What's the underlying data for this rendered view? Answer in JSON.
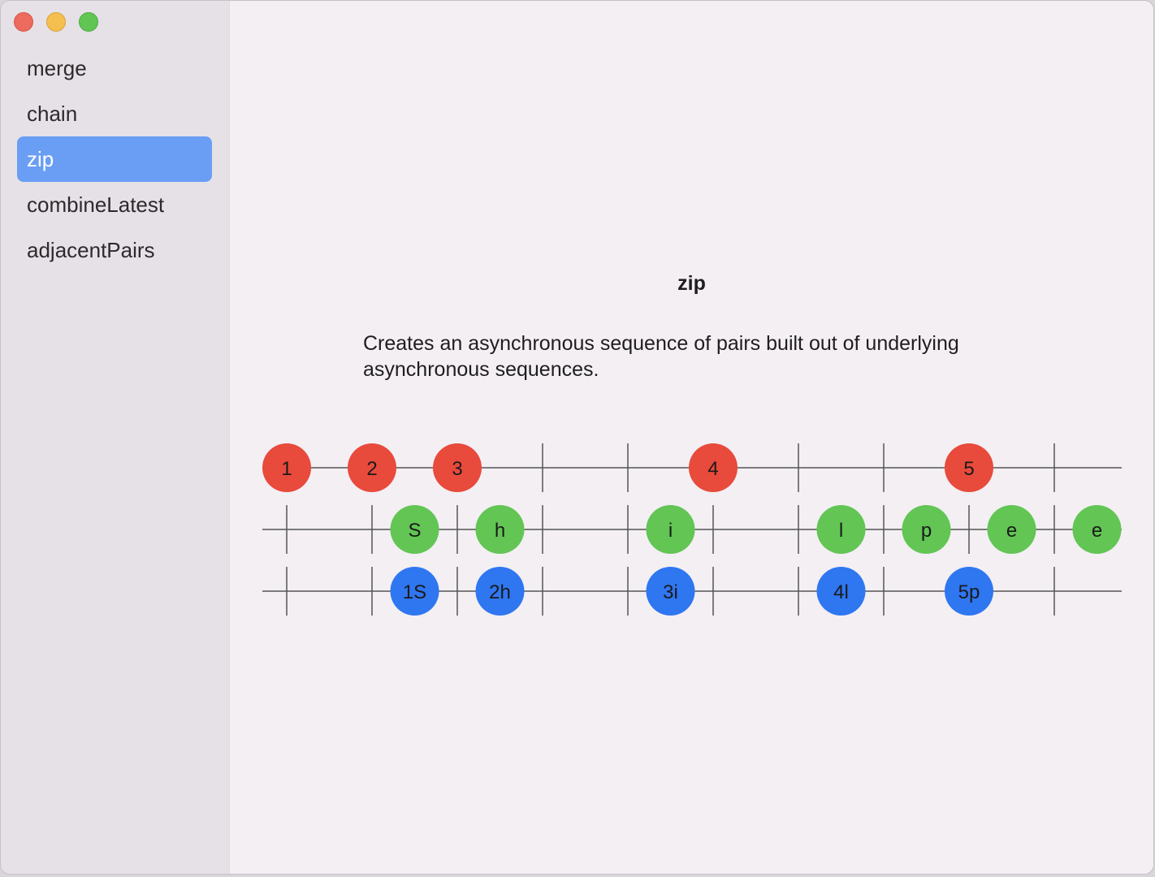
{
  "window": {
    "controls": [
      "close",
      "minimize",
      "maximize"
    ]
  },
  "sidebar": {
    "items": [
      {
        "label": "merge",
        "selected": false
      },
      {
        "label": "chain",
        "selected": false
      },
      {
        "label": "zip",
        "selected": true
      },
      {
        "label": "combineLatest",
        "selected": false
      },
      {
        "label": "adjacentPairs",
        "selected": false
      }
    ]
  },
  "main": {
    "title": "zip",
    "description_line1": "Creates an asynchronous sequence of pairs built out of underlying",
    "description_line2": "asynchronous sequences."
  },
  "diagram": {
    "colors": {
      "red": "#e84a3c",
      "green": "#62c554",
      "blue": "#2f76f1",
      "line": "#555555"
    },
    "rows": [
      {
        "name": "input-1",
        "color": "red",
        "ticks": [
          3,
          4,
          6,
          7,
          9
        ],
        "marbles": [
          {
            "slot": 0,
            "label": "1"
          },
          {
            "slot": 1,
            "label": "2"
          },
          {
            "slot": 2,
            "label": "3"
          },
          {
            "slot": 5,
            "label": "4"
          },
          {
            "slot": 8,
            "label": "5"
          }
        ]
      },
      {
        "name": "input-2",
        "color": "green",
        "ticks": [
          0,
          1,
          2,
          3,
          4,
          5,
          6,
          7,
          8,
          9
        ],
        "marbles": [
          {
            "slot": 1.5,
            "label": "S"
          },
          {
            "slot": 2.5,
            "label": "h"
          },
          {
            "slot": 4.5,
            "label": "i"
          },
          {
            "slot": 6.5,
            "label": "l"
          },
          {
            "slot": 7.5,
            "label": "p"
          },
          {
            "slot": 8.5,
            "label": "e"
          },
          {
            "slot": 9.5,
            "label": "e"
          }
        ]
      },
      {
        "name": "output",
        "color": "blue",
        "ticks": [
          0,
          1,
          2,
          3,
          4,
          5,
          6,
          7,
          9
        ],
        "marbles": [
          {
            "slot": 1.5,
            "label": "1S"
          },
          {
            "slot": 2.5,
            "label": "2h"
          },
          {
            "slot": 4.5,
            "label": "3i"
          },
          {
            "slot": 6.5,
            "label": "4l"
          },
          {
            "slot": 8,
            "label": "5p"
          }
        ]
      }
    ]
  }
}
